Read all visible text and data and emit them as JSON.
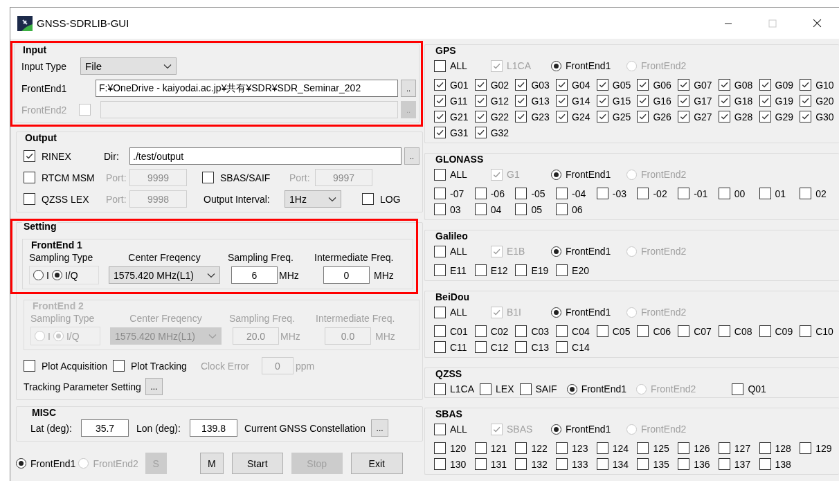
{
  "window": {
    "title": "GNSS-SDRLIB-GUI",
    "maximize_disabled": true
  },
  "input": {
    "title": "Input",
    "highlighted": true,
    "type_label": "Input Type",
    "type": "File",
    "frontend1": {
      "label": "FrontEnd1",
      "path": "F:¥OneDrive - kaiyodai.ac.jp¥共有¥SDR¥SDR_Seminar_202",
      "browse": ".."
    },
    "frontend2": {
      "label": "FrontEnd2",
      "checked": false,
      "disabled": true,
      "browse": ".."
    }
  },
  "output": {
    "title": "Output",
    "rinex": {
      "label": "RINEX",
      "checked": true
    },
    "dir_label": "Dir:",
    "dir": "./test/output",
    "dir_browse": "..",
    "streams": [
      {
        "label": "RTCM MSM",
        "checked": false,
        "port_label": "Port:",
        "port": "9999"
      },
      {
        "label": "SBAS/SAIF",
        "checked": false,
        "port_label": "Port:",
        "port": "9997"
      },
      {
        "label": "QZSS LEX",
        "checked": false,
        "port_label": "Port:",
        "port": "9998"
      }
    ],
    "interval_label": "Output Interval:",
    "interval": "1Hz",
    "log": {
      "label": "LOG",
      "checked": false
    }
  },
  "setting": {
    "title": "Setting",
    "highlighted": true,
    "frontends": [
      {
        "title": "FrontEnd 1",
        "disabled": false,
        "sampling_type_label": "Sampling Type",
        "types": [
          {
            "label": "I",
            "selected": false
          },
          {
            "label": "I/Q",
            "selected": true
          }
        ],
        "center_label": "Center Freqency",
        "center": "1575.420 MHz(L1)",
        "sampling_label": "Sampling Freq.",
        "sampling": "6",
        "sampling_unit": "MHz",
        "if_label": "Intermediate Freq.",
        "if": "0",
        "if_unit": "MHz"
      },
      {
        "title": "FrontEnd 2",
        "disabled": true,
        "sampling_type_label": "Sampling Type",
        "types": [
          {
            "label": "I",
            "selected": false
          },
          {
            "label": "I/Q",
            "selected": true
          }
        ],
        "center_label": "Center Freqency",
        "center": "1575.420 MHz(L1)",
        "sampling_label": "Sampling Freq.",
        "sampling": "20.0",
        "sampling_unit": "MHz",
        "if_label": "Intermediate Freq.",
        "if": "0.0",
        "if_unit": "MHz"
      }
    ],
    "plot_acquisition": {
      "label": "Plot Acquisition",
      "checked": false
    },
    "plot_tracking": {
      "label": "Plot Tracking",
      "checked": false
    },
    "clock_error": {
      "label": "Clock Error",
      "value": "0",
      "unit": "ppm",
      "disabled": true
    },
    "tracking_label": "Tracking Parameter Setting",
    "tracking_button": "..."
  },
  "misc": {
    "title": "MISC",
    "lat_label": "Lat (deg):",
    "lat": "35.7",
    "lon_label": "Lon (deg):",
    "lon": "139.8",
    "constellation_label": "Current GNSS Constellation",
    "constellation_button": "..."
  },
  "bottom": {
    "frontends": [
      {
        "label": "FrontEnd1",
        "selected": true,
        "disabled": false
      },
      {
        "label": "FrontEnd2",
        "selected": false,
        "disabled": true
      }
    ],
    "buttons": [
      {
        "label": "S",
        "disabled": true
      },
      {
        "label": "M",
        "disabled": false
      },
      {
        "label": "Start",
        "disabled": false
      },
      {
        "label": "Stop",
        "disabled": true
      },
      {
        "label": "Exit",
        "disabled": false
      }
    ]
  },
  "systems": [
    {
      "name": "GPS",
      "inline": false,
      "options": [
        {
          "kind": "checkbox",
          "label": "ALL",
          "checked": false,
          "disabled": false
        },
        {
          "kind": "checkbox",
          "label": "L1CA",
          "checked": true,
          "disabled": true
        },
        {
          "kind": "radio",
          "label": "FrontEnd1",
          "selected": true,
          "disabled": false
        },
        {
          "kind": "radio",
          "label": "FrontEnd2",
          "selected": false,
          "disabled": true
        }
      ],
      "satellites": [
        {
          "label": "G01",
          "checked": true
        },
        {
          "label": "G02",
          "checked": true
        },
        {
          "label": "G03",
          "checked": true
        },
        {
          "label": "G04",
          "checked": true
        },
        {
          "label": "G05",
          "checked": true
        },
        {
          "label": "G06",
          "checked": true
        },
        {
          "label": "G07",
          "checked": true
        },
        {
          "label": "G08",
          "checked": true
        },
        {
          "label": "G09",
          "checked": true
        },
        {
          "label": "G10",
          "checked": true
        },
        {
          "label": "G11",
          "checked": true
        },
        {
          "label": "G12",
          "checked": true
        },
        {
          "label": "G13",
          "checked": true
        },
        {
          "label": "G14",
          "checked": true
        },
        {
          "label": "G15",
          "checked": true
        },
        {
          "label": "G16",
          "checked": true
        },
        {
          "label": "G17",
          "checked": true
        },
        {
          "label": "G18",
          "checked": true
        },
        {
          "label": "G19",
          "checked": true
        },
        {
          "label": "G20",
          "checked": true
        },
        {
          "label": "G21",
          "checked": true
        },
        {
          "label": "G22",
          "checked": true
        },
        {
          "label": "G23",
          "checked": true
        },
        {
          "label": "G24",
          "checked": true
        },
        {
          "label": "G25",
          "checked": true
        },
        {
          "label": "G26",
          "checked": true
        },
        {
          "label": "G27",
          "checked": true
        },
        {
          "label": "G28",
          "checked": true
        },
        {
          "label": "G29",
          "checked": true
        },
        {
          "label": "G30",
          "checked": true
        },
        {
          "label": "G31",
          "checked": true
        },
        {
          "label": "G32",
          "checked": true
        }
      ]
    },
    {
      "name": "GLONASS",
      "inline": false,
      "options": [
        {
          "kind": "checkbox",
          "label": "ALL",
          "checked": false,
          "disabled": false
        },
        {
          "kind": "checkbox",
          "label": "G1",
          "checked": true,
          "disabled": true
        },
        {
          "kind": "radio",
          "label": "FrontEnd1",
          "selected": true,
          "disabled": false
        },
        {
          "kind": "radio",
          "label": "FrontEnd2",
          "selected": false,
          "disabled": true
        }
      ],
      "satellites": [
        {
          "label": "-07",
          "checked": false
        },
        {
          "label": "-06",
          "checked": false
        },
        {
          "label": "-05",
          "checked": false
        },
        {
          "label": "-04",
          "checked": false
        },
        {
          "label": "-03",
          "checked": false
        },
        {
          "label": "-02",
          "checked": false
        },
        {
          "label": "-01",
          "checked": false
        },
        {
          "label": "00",
          "checked": false
        },
        {
          "label": "01",
          "checked": false
        },
        {
          "label": "02",
          "checked": false
        },
        {
          "label": "03",
          "checked": false
        },
        {
          "label": "04",
          "checked": false
        },
        {
          "label": "05",
          "checked": false
        },
        {
          "label": "06",
          "checked": false
        }
      ]
    },
    {
      "name": "Galileo",
      "inline": false,
      "options": [
        {
          "kind": "checkbox",
          "label": "ALL",
          "checked": false,
          "disabled": false
        },
        {
          "kind": "checkbox",
          "label": "E1B",
          "checked": true,
          "disabled": true
        },
        {
          "kind": "radio",
          "label": "FrontEnd1",
          "selected": true,
          "disabled": false
        },
        {
          "kind": "radio",
          "label": "FrontEnd2",
          "selected": false,
          "disabled": true
        }
      ],
      "satellites": [
        {
          "label": "E11",
          "checked": false
        },
        {
          "label": "E12",
          "checked": false
        },
        {
          "label": "E19",
          "checked": false
        },
        {
          "label": "E20",
          "checked": false
        }
      ]
    },
    {
      "name": "BeiDou",
      "inline": false,
      "options": [
        {
          "kind": "checkbox",
          "label": "ALL",
          "checked": false,
          "disabled": false
        },
        {
          "kind": "checkbox",
          "label": "B1I",
          "checked": true,
          "disabled": true
        },
        {
          "kind": "radio",
          "label": "FrontEnd1",
          "selected": true,
          "disabled": false
        },
        {
          "kind": "radio",
          "label": "FrontEnd2",
          "selected": false,
          "disabled": true
        }
      ],
      "satellites": [
        {
          "label": "C01",
          "checked": false
        },
        {
          "label": "C02",
          "checked": false
        },
        {
          "label": "C03",
          "checked": false
        },
        {
          "label": "C04",
          "checked": false
        },
        {
          "label": "C05",
          "checked": false
        },
        {
          "label": "C06",
          "checked": false
        },
        {
          "label": "C07",
          "checked": false
        },
        {
          "label": "C08",
          "checked": false
        },
        {
          "label": "C09",
          "checked": false
        },
        {
          "label": "C10",
          "checked": false
        },
        {
          "label": "C11",
          "checked": false
        },
        {
          "label": "C12",
          "checked": false
        },
        {
          "label": "C13",
          "checked": false
        },
        {
          "label": "C14",
          "checked": false
        }
      ]
    },
    {
      "name": "QZSS",
      "inline": true,
      "options": [
        {
          "kind": "checkbox",
          "label": "L1CA",
          "checked": false,
          "disabled": false
        },
        {
          "kind": "checkbox",
          "label": "LEX",
          "checked": false,
          "disabled": false
        },
        {
          "kind": "checkbox",
          "label": "SAIF",
          "checked": false,
          "disabled": false
        },
        {
          "kind": "radio",
          "label": "FrontEnd1",
          "selected": true,
          "disabled": false
        },
        {
          "kind": "radio",
          "label": "FrontEnd2",
          "selected": false,
          "disabled": true
        }
      ],
      "satellites": [
        {
          "label": "Q01",
          "checked": false
        }
      ]
    },
    {
      "name": "SBAS",
      "inline": false,
      "options": [
        {
          "kind": "checkbox",
          "label": "ALL",
          "checked": false,
          "disabled": false
        },
        {
          "kind": "checkbox",
          "label": "SBAS",
          "checked": true,
          "disabled": true
        },
        {
          "kind": "radio",
          "label": "FrontEnd1",
          "selected": true,
          "disabled": false
        },
        {
          "kind": "radio",
          "label": "FrontEnd2",
          "selected": false,
          "disabled": true
        }
      ],
      "satellites": [
        {
          "label": "120",
          "checked": false
        },
        {
          "label": "121",
          "checked": false
        },
        {
          "label": "122",
          "checked": false
        },
        {
          "label": "123",
          "checked": false
        },
        {
          "label": "124",
          "checked": false
        },
        {
          "label": "125",
          "checked": false
        },
        {
          "label": "126",
          "checked": false
        },
        {
          "label": "127",
          "checked": false
        },
        {
          "label": "128",
          "checked": false
        },
        {
          "label": "129",
          "checked": false
        },
        {
          "label": "130",
          "checked": false
        },
        {
          "label": "131",
          "checked": false
        },
        {
          "label": "132",
          "checked": false
        },
        {
          "label": "133",
          "checked": false
        },
        {
          "label": "134",
          "checked": false
        },
        {
          "label": "135",
          "checked": false
        },
        {
          "label": "136",
          "checked": false
        },
        {
          "label": "137",
          "checked": false
        },
        {
          "label": "138",
          "checked": false
        }
      ]
    }
  ]
}
